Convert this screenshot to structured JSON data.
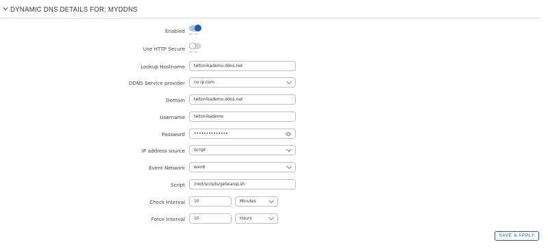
{
  "section": {
    "title": "DYNAMIC DNS DETAILS FOR: MYDDNS"
  },
  "toggle_labels": {
    "off": "off",
    "on": "on"
  },
  "fields": {
    "enabled": {
      "label": "Enabled",
      "state": "on"
    },
    "https": {
      "label": "Use HTTP Secure",
      "state": "off"
    },
    "lookup_hostname": {
      "label": "Lookup Hostname",
      "value": "teltonikademo.ddns.net"
    },
    "service_provider": {
      "label": "DDNS Service provider",
      "value": "no-ip.com"
    },
    "domain": {
      "label": "Domain",
      "value": "teltonikademo.ddns.net"
    },
    "username": {
      "label": "Username",
      "value": "teltonikademo"
    },
    "password": {
      "label": "Password",
      "value": "••••••••••••••"
    },
    "ip_source": {
      "label": "IP address source",
      "value": "Script"
    },
    "event_network": {
      "label": "Event Network",
      "value": "wan6"
    },
    "script": {
      "label": "Script",
      "value": "/root/scripts/getwanip.sh"
    },
    "check_interval": {
      "label": "Check Interval",
      "value": "10",
      "unit": "Minutes"
    },
    "force_interval": {
      "label": "Force Interval",
      "value": "10",
      "unit": "Hours"
    }
  },
  "buttons": {
    "save_apply": "SAVE & APPLY"
  },
  "colors": {
    "accent": "#1e5ca8",
    "border": "#bfbfbf"
  }
}
